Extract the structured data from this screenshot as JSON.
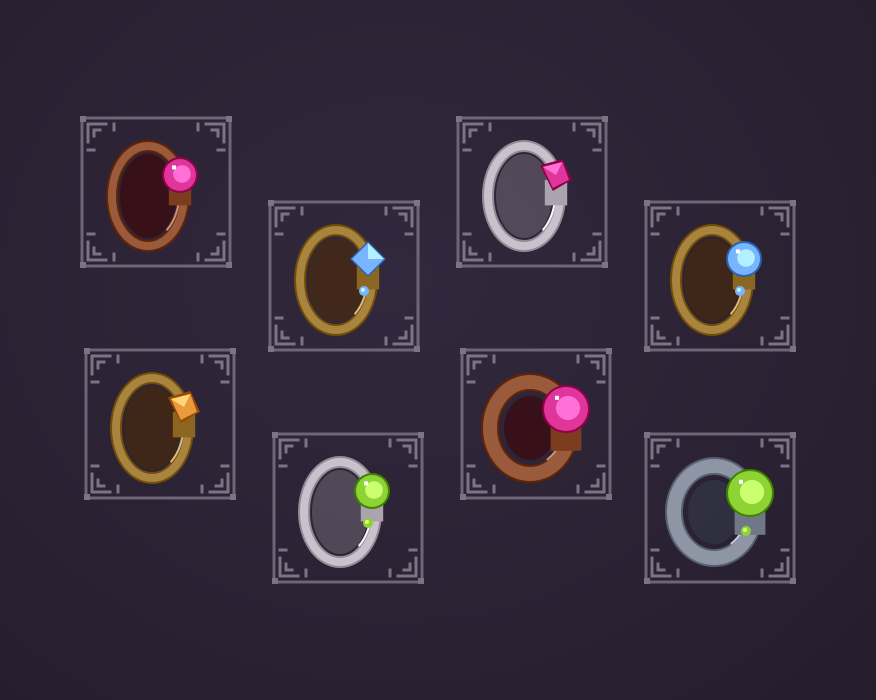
{
  "inventory": {
    "slots": [
      {
        "id": "ring-1",
        "band": "copper",
        "gem": "magenta",
        "cut": "round"
      },
      {
        "id": "ring-2",
        "band": "gold",
        "gem": "sapphire",
        "cut": "square"
      },
      {
        "id": "ring-3",
        "band": "silver",
        "gem": "magenta",
        "cut": "pyramid"
      },
      {
        "id": "ring-4",
        "band": "gold",
        "gem": "sapphire",
        "cut": "round"
      },
      {
        "id": "ring-5",
        "band": "gold",
        "gem": "amber",
        "cut": "pyramid"
      },
      {
        "id": "ring-6",
        "band": "silver",
        "gem": "emerald",
        "cut": "round"
      },
      {
        "id": "ring-7",
        "band": "copper",
        "gem": "magenta",
        "cut": "round"
      },
      {
        "id": "ring-8",
        "band": "steel",
        "gem": "emerald",
        "cut": "round"
      }
    ]
  },
  "colors": {
    "background": "#2b2234",
    "frame": "#6d6676",
    "gold": "#a8843e",
    "copper": "#9a5a3c",
    "silver": "#c9c2cc",
    "steel": "#8e96a6",
    "magenta": "#e0359b",
    "sapphire": "#78b4ff",
    "amber": "#e89a3c",
    "emerald": "#8ed334"
  }
}
